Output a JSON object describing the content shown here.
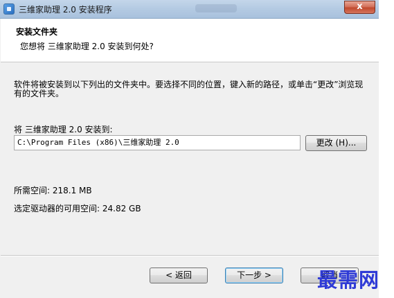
{
  "window": {
    "title": "三维家助理 2.0 安装程序",
    "close_label": "x"
  },
  "header": {
    "title": "安装文件夹",
    "subtitle": "您想将 三维家助理 2.0 安装到何处?"
  },
  "body": {
    "description": "软件将被安装到以下列出的文件夹中。要选择不同的位置，键入新的路径，或单击“更改”浏览现有的文件夹。",
    "install_label": "将 三维家助理 2.0 安装到:",
    "install_path": "C:\\Program Files (x86)\\三维家助理 2.0",
    "change_button": "更改 (H)...",
    "space_required": "所需空间: 218.1 MB",
    "space_available": "选定驱动器的可用空间: 24.82 GB"
  },
  "footer": {
    "back_button": "< 返回",
    "next_button": "下一步 >",
    "cancel_button": "取消"
  },
  "watermark": "最需网",
  "colors": {
    "titlebar": "#b5cbe3",
    "close_button": "#c1492e",
    "dialog_bg": "#f0f0f0",
    "watermark": "#2f3bd6"
  },
  "icons": {
    "app": "installer-app-icon",
    "close": "close-icon"
  }
}
